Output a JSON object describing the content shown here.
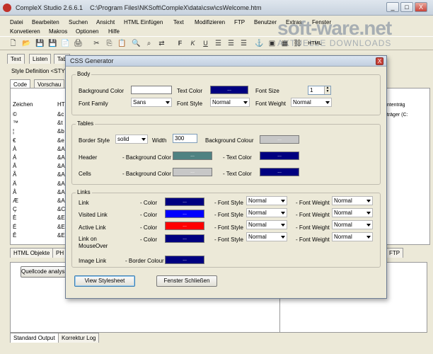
{
  "app": {
    "title": "CompleX Studio 2.6.6.1",
    "path": "C:\\Program Files\\NKSoft\\CompleX\\data\\csw\\csWelcome.htm",
    "window_buttons": [
      "_",
      "□",
      "X"
    ]
  },
  "menu": {
    "row1": [
      "Datei",
      "Bearbeiten",
      "Suchen",
      "Ansicht",
      "HTML Einfügen",
      "Text",
      "Modifizieren",
      "FTP",
      "Benutzer",
      "Extras",
      "Fenster"
    ],
    "row2": [
      "Konvetieren",
      "Makros",
      "Optionen",
      "Hilfe"
    ]
  },
  "watermark": {
    "text": "soft-ware.net",
    "sub": "AKTUELLE DOWNLOADS"
  },
  "toolbar": {
    "icons": [
      "new-file-icon",
      "open-folder-icon",
      "save-icon",
      "save-all-icon",
      "copy-doc-icon",
      "print-icon",
      "cut-icon",
      "copy-icon",
      "paste-icon",
      "find-icon",
      "find-next-icon",
      "replace-icon",
      "bold-icon",
      "italic-icon",
      "underline-icon",
      "align-left-icon",
      "align-center-icon",
      "align-right-icon",
      "anchor-icon",
      "image-icon",
      "table-icon",
      "link-icon"
    ],
    "glyphs": [
      "🗋",
      "📂",
      "💾",
      "💾",
      "📄",
      "🖨",
      "✂",
      "⎘",
      "📋",
      "🔍",
      "⌕",
      "⇄",
      "F",
      "K",
      "U",
      "☰",
      "☰",
      "☰",
      "⚓",
      "▣",
      "▦",
      "⛓"
    ],
    "html_label": "HTML"
  },
  "tabs": {
    "top": [
      "Text",
      "Listen",
      "Tab"
    ],
    "style_def": "Style Definition <STYL",
    "editor": [
      "Code",
      "Vorschau"
    ],
    "bottom_left": [
      "HTML Objekte",
      "PH"
    ],
    "bottom_right": "FTP",
    "output_button": "Quellcode analysieren",
    "output": [
      "Standard Output",
      "Korrektur Log"
    ]
  },
  "left_panel": {
    "headers": [
      "Zeichen",
      "HT"
    ],
    "rows": [
      [
        "©",
        "&c"
      ],
      [
        "™",
        "&t"
      ],
      [
        "¦",
        "&b"
      ],
      [
        "€",
        "&e"
      ],
      [
        "À",
        "&A"
      ],
      [
        "Á",
        "&A"
      ],
      [
        "Â",
        "&A"
      ],
      [
        "Ã",
        "&A"
      ],
      [
        "Ä",
        "&A"
      ],
      [
        "Å",
        "&A"
      ],
      [
        "Æ",
        "&A"
      ],
      [
        "Ç",
        "&C"
      ],
      [
        "È",
        "&E"
      ],
      [
        "É",
        "&E"
      ],
      [
        "Ê",
        "&E"
      ]
    ]
  },
  "right_panel": {
    "lines": [
      "ontenträg",
      "nträger (C:"
    ]
  },
  "dialog": {
    "title": "CSS Generator",
    "close": "X",
    "body": {
      "title": "Body",
      "bg_label": "Background Color",
      "text_color_label": "Text Color",
      "font_size_label": "Font Size",
      "font_size_value": "1",
      "font_family_label": "Font Family",
      "font_family_value": "Sans",
      "font_style_label": "Font Style",
      "font_style_value": "Normal",
      "font_weight_label": "Font Weight",
      "font_weight_value": "Normal"
    },
    "tables": {
      "title": "Tables",
      "border_style_label": "Border Style",
      "border_style_value": "solid",
      "width_label": "Width",
      "width_value": "300",
      "bg_colour_label": "Background Colour",
      "header_label": "Header",
      "cells_label": "Cells",
      "bg_color_label": "- Background Color",
      "text_color_label": "- Text Color"
    },
    "links": {
      "title": "Links",
      "color_label": "- Color",
      "font_style_label": "- Font Style",
      "font_weight_label": "- Font Weight",
      "normal": "Normal",
      "rows": [
        "Link",
        "Visited Link",
        "Active Link",
        "Link on MouseOver"
      ],
      "image_link_label": "Image Link",
      "border_colour_label": "- Border Colour"
    },
    "swatch_text": "...",
    "view_button": "View Stylesheet",
    "close_button": "Fenster Schließen"
  },
  "colors": {
    "navy": "#000080",
    "blue": "#0000ff",
    "red": "#ff0000",
    "teal": "#4f8282",
    "light_grey": "#c7c7c7",
    "white": "#ffffff"
  }
}
